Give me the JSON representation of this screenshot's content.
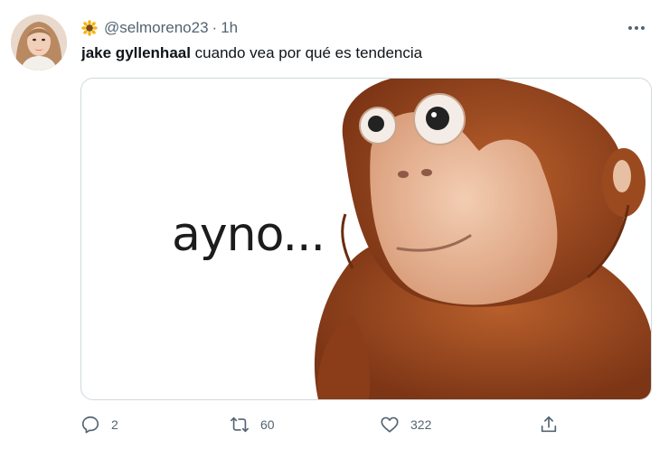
{
  "tweet": {
    "handle": "@selmoreno23",
    "separator": "·",
    "time": "1h",
    "text_bold": "jake gyllenhaal",
    "text_rest": " cuando vea por qué es tendencia",
    "image_text": "ayno...",
    "actions": {
      "replies": "2",
      "retweets": "60",
      "likes": "322"
    }
  },
  "icons": {
    "avatar": "profile-photo",
    "name_emoji": "sunflower-icon",
    "more": "more-dots-icon",
    "reply": "reply-icon",
    "retweet": "retweet-icon",
    "like": "heart-icon",
    "share": "share-icon"
  },
  "colors": {
    "secondary_text": "#536471",
    "border": "#cfd9de",
    "monkey_fur": "#9b4a1f",
    "monkey_face": "#e7b596"
  }
}
